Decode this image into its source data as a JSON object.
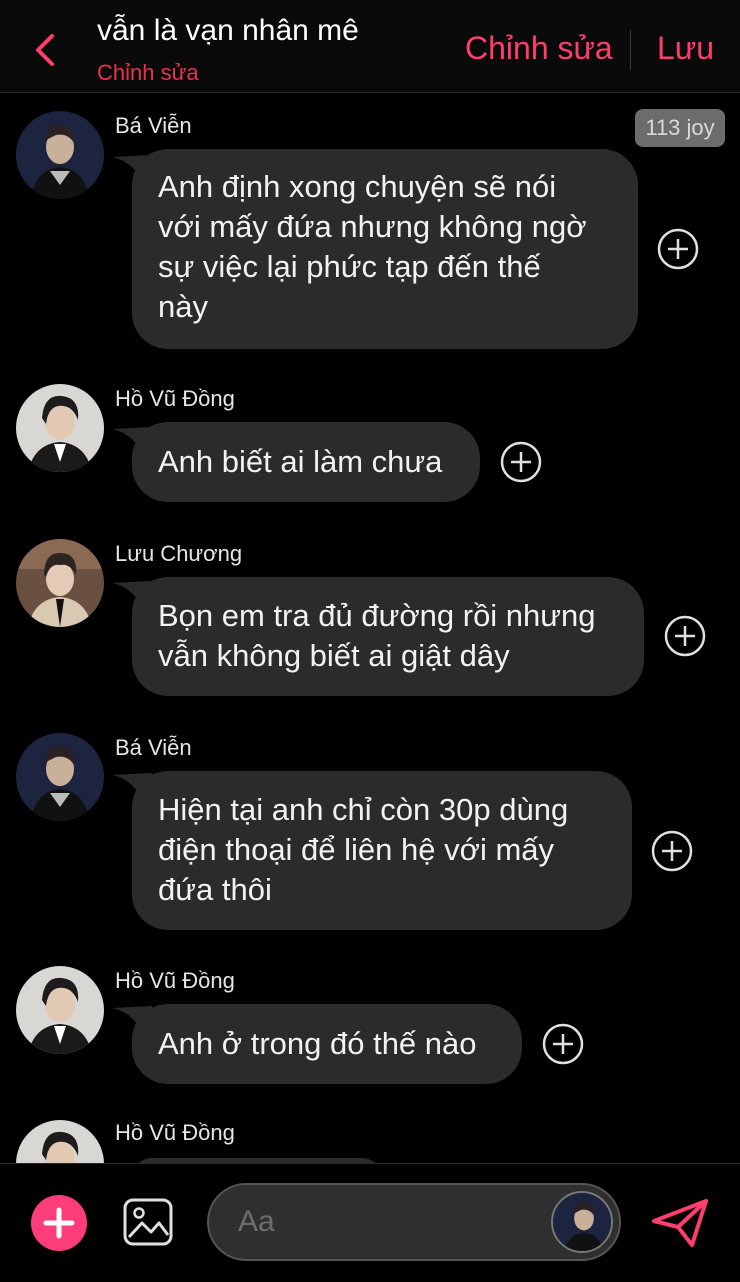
{
  "header": {
    "title": "vẫn là vạn nhân mê",
    "subtitle": "Chỉnh sửa",
    "edit_label": "Chỉnh sửa",
    "save_label": "Lưu"
  },
  "badge": "113 joy",
  "messages": [
    {
      "name": "Bá Viễn",
      "lines": [
        "Anh định xong chuyện sẽ nói",
        "với mấy đứa nhưng không ngờ",
        "sự việc lại phức tạp đến thế",
        "này"
      ]
    },
    {
      "name": "Hồ Vũ Đồng",
      "lines": [
        "Anh biết ai làm chưa"
      ]
    },
    {
      "name": "Lưu Chương",
      "lines": [
        "Bọn em tra đủ đường rồi nhưng",
        "vẫn không biết ai giật dây"
      ]
    },
    {
      "name": "Bá Viễn",
      "lines": [
        "Hiện tại anh chỉ còn 30p dùng",
        "điện thoại để liên hệ với mấy",
        "đứa thôi"
      ]
    },
    {
      "name": "Hồ Vũ Đồng",
      "lines": [
        "Anh ở trong đó thế nào"
      ]
    },
    {
      "name": "Hồ Vũ Đồng",
      "lines": []
    }
  ],
  "footer": {
    "input_placeholder": "Aa"
  },
  "colors": {
    "accent": "#ff3d6e",
    "bubble": "#2b2b2b",
    "background": "#000000"
  }
}
